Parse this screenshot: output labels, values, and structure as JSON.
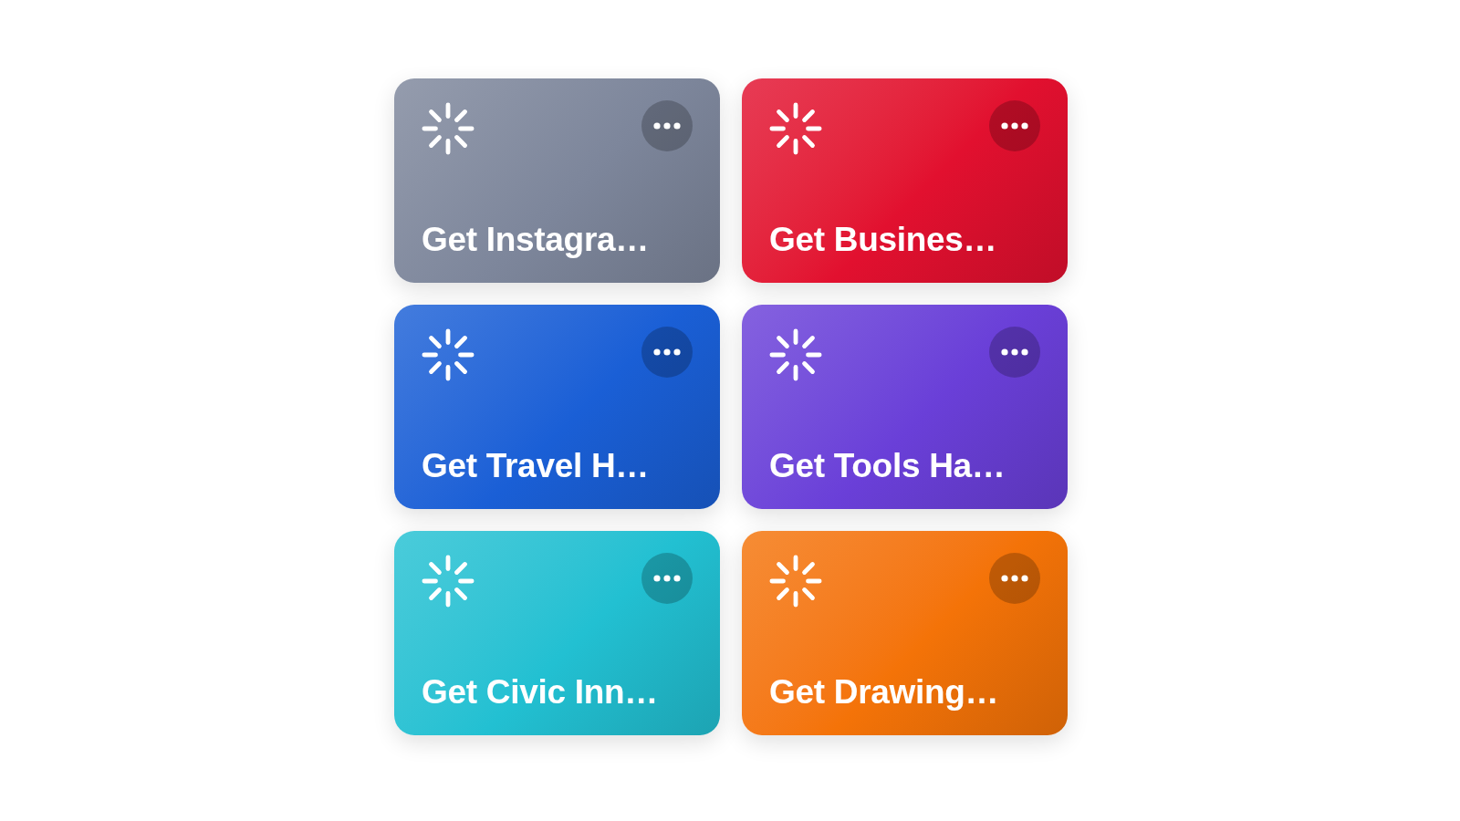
{
  "shortcuts": [
    {
      "title": "Get Instagra…",
      "color": "#7d869b"
    },
    {
      "title": "Get Busines…",
      "color": "#e2102f"
    },
    {
      "title": "Get Travel H…",
      "color": "#1a5fd6"
    },
    {
      "title": "Get Tools Ha…",
      "color": "#6a3fd8"
    },
    {
      "title": "Get Civic Inn…",
      "color": "#22c0d2"
    },
    {
      "title": "Get Drawing…",
      "color": "#f47308"
    }
  ]
}
